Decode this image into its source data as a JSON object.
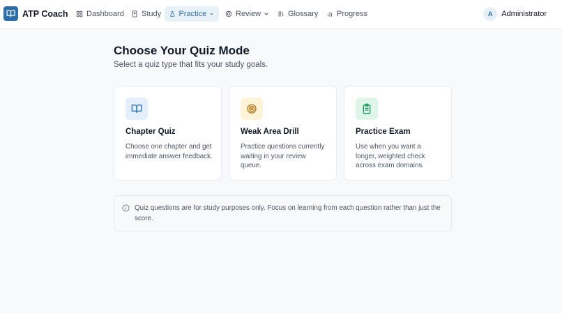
{
  "app": {
    "name": "ATP Coach"
  },
  "nav": {
    "dashboard": "Dashboard",
    "study": "Study",
    "practice": "Practice",
    "review": "Review",
    "glossary": "Glossary",
    "progress": "Progress"
  },
  "user": {
    "initial": "A",
    "name": "Administrator"
  },
  "page": {
    "title": "Choose Your Quiz Mode",
    "subtitle": "Select a quiz type that fits your study goals."
  },
  "cards": [
    {
      "title": "Chapter Quiz",
      "description": "Choose one chapter and get immediate answer feedback.",
      "icon": "book-open-icon",
      "accent": "#2f6fa8",
      "icon_bg": "#e3effa"
    },
    {
      "title": "Weak Area Drill",
      "description": "Practice questions currently waiting in your review queue.",
      "icon": "target-icon",
      "accent": "#b7791f",
      "icon_bg": "#fdf3d6"
    },
    {
      "title": "Practice Exam",
      "description": "Use when you want a longer, weighted check across exam domains.",
      "icon": "clipboard-list-icon",
      "accent": "#1f9d63",
      "icon_bg": "#dff5ea"
    }
  ],
  "notice": {
    "text": "Quiz questions are for study purposes only. Focus on learning from each question rather than just the score.",
    "icon": "info-icon"
  },
  "colors": {
    "primary": "#2f6fa8",
    "background": "#f8f9fb",
    "active_nav_bg": "#e9f1f8"
  }
}
